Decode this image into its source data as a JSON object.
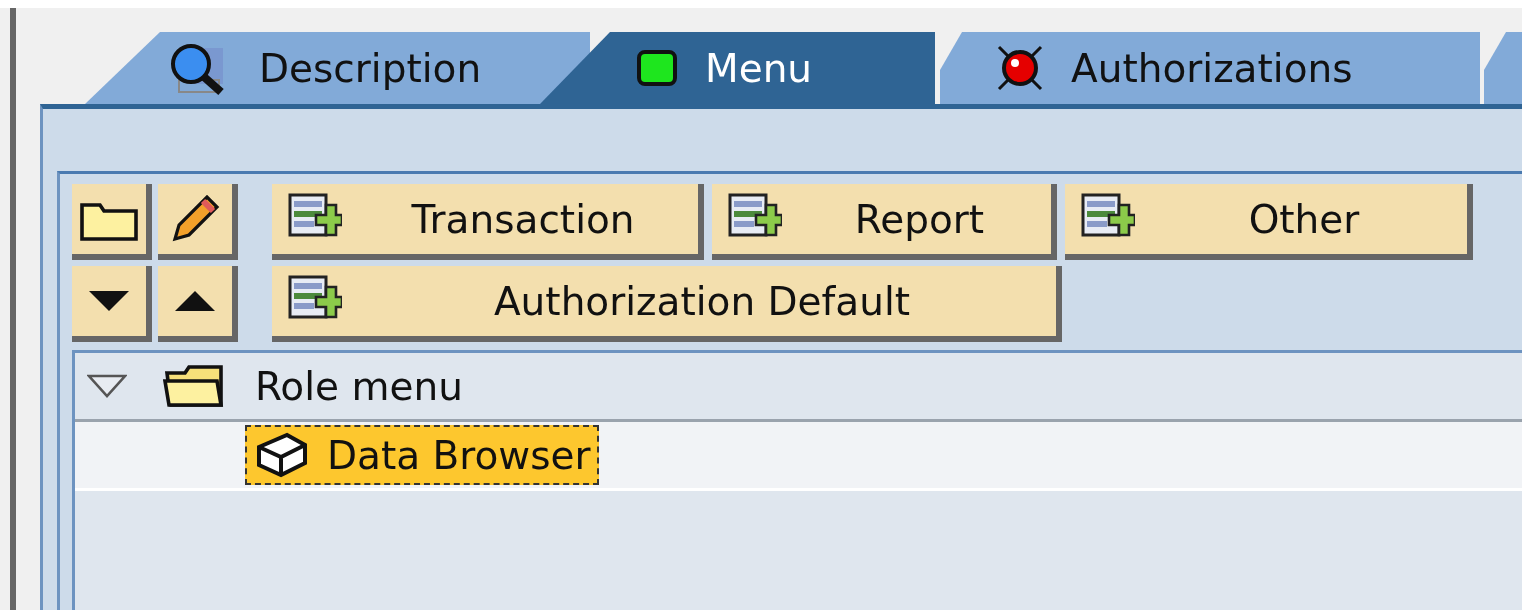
{
  "tabs": [
    {
      "label": "Description",
      "selected": false,
      "kind": "magnifier"
    },
    {
      "label": "Menu",
      "selected": true,
      "kind": "green"
    },
    {
      "label": "Authorizations",
      "selected": false,
      "kind": "red"
    }
  ],
  "toolbar": {
    "button_rows": [
      [
        {
          "label": "Transaction"
        },
        {
          "label": "Report"
        },
        {
          "label": "Other"
        }
      ],
      [
        {
          "label": "Authorization Default"
        }
      ]
    ]
  },
  "tree": [
    {
      "label": "Role menu",
      "expanded": true,
      "children": [
        {
          "label": "Data Browser",
          "selected": true
        }
      ]
    }
  ]
}
